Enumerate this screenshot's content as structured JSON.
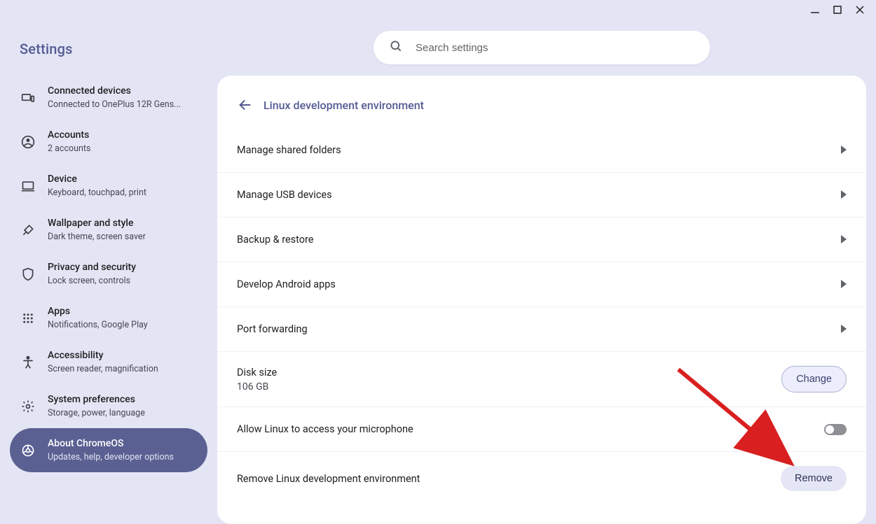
{
  "app": {
    "title": "Settings"
  },
  "search": {
    "placeholder": "Search settings"
  },
  "sidebar": {
    "items": [
      {
        "label": "Connected devices",
        "sub": "Connected to OnePlus 12R Gens..."
      },
      {
        "label": "Accounts",
        "sub": "2 accounts"
      },
      {
        "label": "Device",
        "sub": "Keyboard, touchpad, print"
      },
      {
        "label": "Wallpaper and style",
        "sub": "Dark theme, screen saver"
      },
      {
        "label": "Privacy and security",
        "sub": "Lock screen, controls"
      },
      {
        "label": "Apps",
        "sub": "Notifications, Google Play"
      },
      {
        "label": "Accessibility",
        "sub": "Screen reader, magnification"
      },
      {
        "label": "System preferences",
        "sub": "Storage, power, language"
      },
      {
        "label": "About ChromeOS",
        "sub": "Updates, help, developer options"
      }
    ]
  },
  "panel": {
    "title": "Linux development environment",
    "rows": {
      "shared_folders": "Manage shared folders",
      "usb": "Manage USB devices",
      "backup": "Backup & restore",
      "android": "Develop Android apps",
      "port": "Port forwarding",
      "disk_label": "Disk size",
      "disk_value": "106 GB",
      "disk_button": "Change",
      "mic": "Allow Linux to access your microphone",
      "remove_label": "Remove Linux development environment",
      "remove_button": "Remove"
    }
  }
}
